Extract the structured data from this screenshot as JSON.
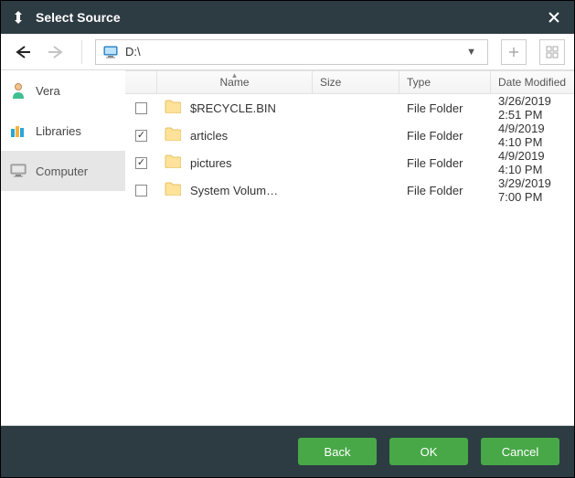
{
  "window": {
    "title": "Select Source"
  },
  "path": {
    "text": "D:\\"
  },
  "sidebar": {
    "items": [
      {
        "label": "Vera",
        "icon": "user-icon",
        "selected": false
      },
      {
        "label": "Libraries",
        "icon": "libraries-icon",
        "selected": false
      },
      {
        "label": "Computer",
        "icon": "monitor-icon",
        "selected": true
      }
    ]
  },
  "columns": {
    "name": "Name",
    "size": "Size",
    "type": "Type",
    "date": "Date Modified"
  },
  "rows": [
    {
      "checked": false,
      "name": "$RECYCLE.BIN",
      "size": "",
      "type": "File Folder",
      "date": "3/26/2019 2:51 PM"
    },
    {
      "checked": true,
      "name": "articles",
      "size": "",
      "type": "File Folder",
      "date": "4/9/2019 4:10 PM"
    },
    {
      "checked": true,
      "name": "pictures",
      "size": "",
      "type": "File Folder",
      "date": "4/9/2019 4:10 PM"
    },
    {
      "checked": false,
      "name": "System Volum…",
      "size": "",
      "type": "File Folder",
      "date": "3/29/2019 7:00 PM"
    }
  ],
  "buttons": {
    "back": "Back",
    "ok": "OK",
    "cancel": "Cancel"
  },
  "colors": {
    "accent": "#48a848",
    "chrome": "#2d3b43"
  }
}
